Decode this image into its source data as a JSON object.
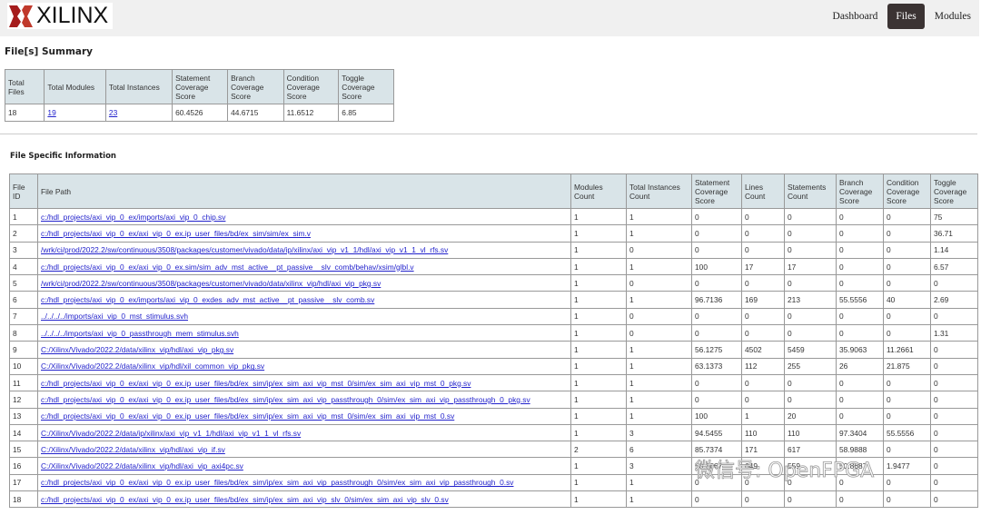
{
  "header": {
    "logo": "XILINX",
    "nav": [
      {
        "label": "Dashboard",
        "active": false
      },
      {
        "label": "Files",
        "active": true
      },
      {
        "label": "Modules",
        "active": false
      }
    ]
  },
  "summary": {
    "title": "File[s] Summary",
    "headers": [
      "Total Files",
      "Total Modules",
      "Total Instances",
      "Statement Coverage Score",
      "Branch Coverage Score",
      "Condition Coverage Score",
      "Toggle Coverage Score"
    ],
    "values": [
      "18",
      "19",
      "23",
      "60.4526",
      "44.6715",
      "11.6512",
      "6.85"
    ]
  },
  "files": {
    "title": "File Specific Information",
    "headers": [
      "File ID",
      "File Path",
      "Modules Count",
      "Total Instances Count",
      "Statement Coverage Score",
      "Lines Count",
      "Statements Count",
      "Branch Coverage Score",
      "Condition Coverage Score",
      "Toggle Coverage Score"
    ],
    "rows": [
      [
        "1",
        "c:/hdl_projects/axi_vip_0_ex/imports/axi_vip_0_chip.sv",
        "1",
        "1",
        "0",
        "0",
        "0",
        "0",
        "0",
        "75"
      ],
      [
        "2",
        "c:/hdl_projects/axi_vip_0_ex/axi_vip_0_ex.ip_user_files/bd/ex_sim/sim/ex_sim.v",
        "1",
        "1",
        "0",
        "0",
        "0",
        "0",
        "0",
        "36.71"
      ],
      [
        "3",
        "/wrk/ci/prod/2022.2/sw/continuous/3508/packages/customer/vivado/data/ip/xilinx/axi_vip_v1_1/hdl/axi_vip_v1_1_vl_rfs.sv",
        "1",
        "0",
        "0",
        "0",
        "0",
        "0",
        "0",
        "1.14"
      ],
      [
        "4",
        "c:/hdl_projects/axi_vip_0_ex/axi_vip_0_ex.sim/sim_adv_mst_active__pt_passive__slv_comb/behav/xsim/glbl.v",
        "1",
        "1",
        "100",
        "17",
        "17",
        "0",
        "0",
        "6.57"
      ],
      [
        "5",
        "/wrk/ci/prod/2022.2/sw/continuous/3508/packages/customer/vivado/data/xilinx_vip/hdl/axi_vip_pkg.sv",
        "1",
        "0",
        "0",
        "0",
        "0",
        "0",
        "0",
        "0"
      ],
      [
        "6",
        "c:/hdl_projects/axi_vip_0_ex/imports/axi_vip_0_exdes_adv_mst_active__pt_passive__slv_comb.sv",
        "1",
        "1",
        "96.7136",
        "169",
        "213",
        "55.5556",
        "40",
        "2.69"
      ],
      [
        "7",
        "../../../../imports/axi_vip_0_mst_stimulus.svh",
        "1",
        "0",
        "0",
        "0",
        "0",
        "0",
        "0",
        "0"
      ],
      [
        "8",
        "../../../../imports/axi_vip_0_passthrough_mem_stimulus.svh",
        "1",
        "0",
        "0",
        "0",
        "0",
        "0",
        "0",
        "1.31"
      ],
      [
        "9",
        "C:/Xilinx/Vivado/2022.2/data/xilinx_vip/hdl/axi_vip_pkg.sv",
        "1",
        "1",
        "56.1275",
        "4502",
        "5459",
        "35.9063",
        "11.2661",
        "0"
      ],
      [
        "10",
        "C:/Xilinx/Vivado/2022.2/data/xilinx_vip/hdl/xil_common_vip_pkg.sv",
        "1",
        "1",
        "63.1373",
        "112",
        "255",
        "26",
        "21.875",
        "0"
      ],
      [
        "11",
        "c:/hdl_projects/axi_vip_0_ex/axi_vip_0_ex.ip_user_files/bd/ex_sim/ip/ex_sim_axi_vip_mst_0/sim/ex_sim_axi_vip_mst_0_pkg.sv",
        "1",
        "1",
        "0",
        "0",
        "0",
        "0",
        "0",
        "0"
      ],
      [
        "12",
        "c:/hdl_projects/axi_vip_0_ex/axi_vip_0_ex.ip_user_files/bd/ex_sim/ip/ex_sim_axi_vip_passthrough_0/sim/ex_sim_axi_vip_passthrough_0_pkg.sv",
        "1",
        "1",
        "0",
        "0",
        "0",
        "0",
        "0",
        "0"
      ],
      [
        "13",
        "c:/hdl_projects/axi_vip_0_ex/axi_vip_0_ex.ip_user_files/bd/ex_sim/ip/ex_sim_axi_vip_mst_0/sim/ex_sim_axi_vip_mst_0.sv",
        "1",
        "1",
        "100",
        "1",
        "20",
        "0",
        "0",
        "0"
      ],
      [
        "14",
        "C:/Xilinx/Vivado/2022.2/data/ip/xilinx/axi_vip_v1_1/hdl/axi_vip_v1_1_vl_rfs.sv",
        "1",
        "3",
        "94.5455",
        "110",
        "110",
        "97.3404",
        "55.5556",
        "0"
      ],
      [
        "15",
        "C:/Xilinx/Vivado/2022.2/data/xilinx_vip/hdl/axi_vip_if.sv",
        "2",
        "6",
        "85.7374",
        "171",
        "617",
        "58.9888",
        "0",
        "0"
      ],
      [
        "16",
        "C:/Xilinx/Vivado/2022.2/data/xilinx_vip/hdl/axi_vip_axi4pc.sv",
        "1",
        "3",
        "50.3667",
        "649",
        "559",
        "50.8687",
        "1.9477",
        "0"
      ],
      [
        "17",
        "c:/hdl_projects/axi_vip_0_ex/axi_vip_0_ex.ip_user_files/bd/ex_sim/ip/ex_sim_axi_vip_passthrough_0/sim/ex_sim_axi_vip_passthrough_0.sv",
        "1",
        "1",
        "0",
        "0",
        "0",
        "0",
        "0",
        "0"
      ],
      [
        "18",
        "c:/hdl_projects/axi_vip_0_ex/axi_vip_0_ex.ip_user_files/bd/ex_sim/ip/ex_sim_axi_vip_slv_0/sim/ex_sim_axi_vip_slv_0.sv",
        "1",
        "1",
        "0",
        "0",
        "0",
        "0",
        "0",
        "0"
      ]
    ]
  },
  "watermark": "微信号: OpenFPGA",
  "colors": {
    "header_bg": "#d9e4e8",
    "link": "#2222cc",
    "nav_active": "#3b3333",
    "logo_red": "#b22222"
  }
}
